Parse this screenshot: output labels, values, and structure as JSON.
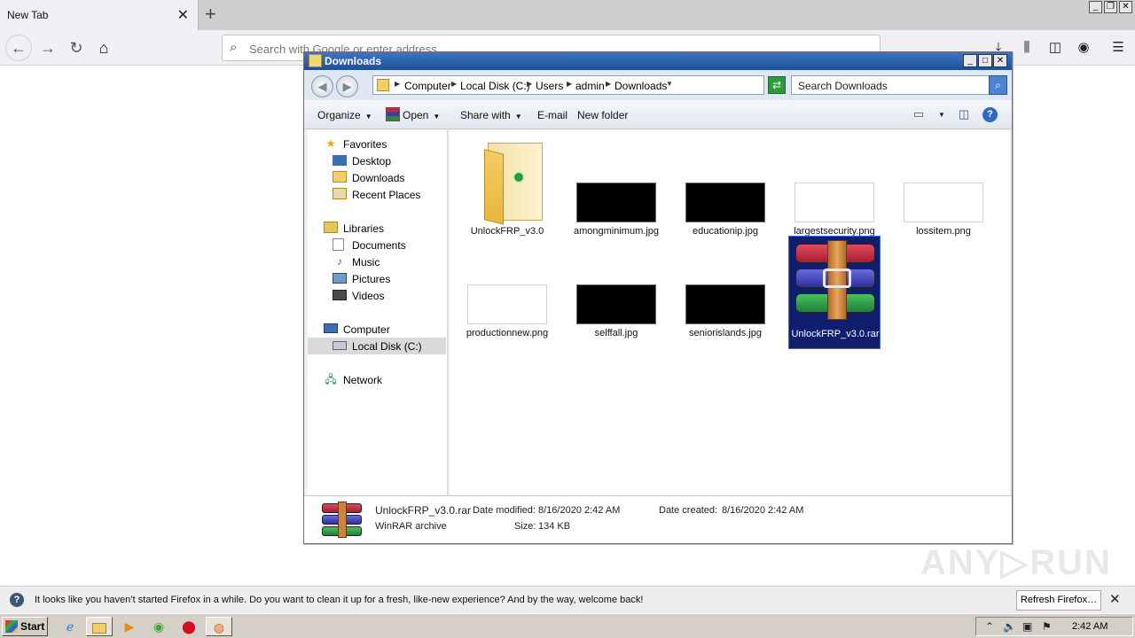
{
  "browser": {
    "tab_title": "New Tab",
    "tab_close": "✕",
    "new_tab": "+",
    "url_placeholder": "Search with Google or enter address"
  },
  "explorer": {
    "title": "Downloads",
    "breadcrumbs": [
      "Computer",
      "Local Disk (C:)",
      "Users",
      "admin",
      "Downloads"
    ],
    "search_placeholder": "Search Downloads",
    "toolbar": {
      "organize": "Organize",
      "open": "Open",
      "share_with": "Share with",
      "email": "E-mail",
      "new_folder": "New folder"
    },
    "nav": {
      "favorites": "Favorites",
      "desktop": "Desktop",
      "downloads": "Downloads",
      "recent_places": "Recent Places",
      "libraries": "Libraries",
      "documents": "Documents",
      "music": "Music",
      "pictures": "Pictures",
      "videos": "Videos",
      "computer": "Computer",
      "local_disk": "Local Disk (C:)",
      "network": "Network"
    },
    "files": [
      {
        "name": "UnlockFRP_v3.0",
        "type": "folder"
      },
      {
        "name": "amongminimum.jpg",
        "type": "dark"
      },
      {
        "name": "educationip.jpg",
        "type": "dark"
      },
      {
        "name": "largestsecurity.png",
        "type": "light"
      },
      {
        "name": "lossitem.png",
        "type": "light"
      },
      {
        "name": "productionnew.png",
        "type": "light"
      },
      {
        "name": "selffall.jpg",
        "type": "dark"
      },
      {
        "name": "seniorislands.jpg",
        "type": "dark"
      },
      {
        "name": "UnlockFRP_v3.0.rar",
        "type": "rar"
      }
    ],
    "details": {
      "name": "UnlockFRP_v3.0.rar",
      "type": "WinRAR archive",
      "date_modified_label": "Date modified:",
      "date_modified": "8/16/2020 2:42 AM",
      "date_created_label": "Date created:",
      "date_created": "8/16/2020 2:42 AM",
      "size_label": "Size:",
      "size": "134 KB"
    }
  },
  "notification": {
    "text": "It looks like you haven’t started Firefox in a while. Do you want to clean it up for a fresh, like-new experience? And by the way, welcome back!",
    "button": "Refresh Firefox…"
  },
  "taskbar": {
    "start": "Start",
    "clock": "2:42 AM"
  },
  "watermark": "ANY▷RUN"
}
